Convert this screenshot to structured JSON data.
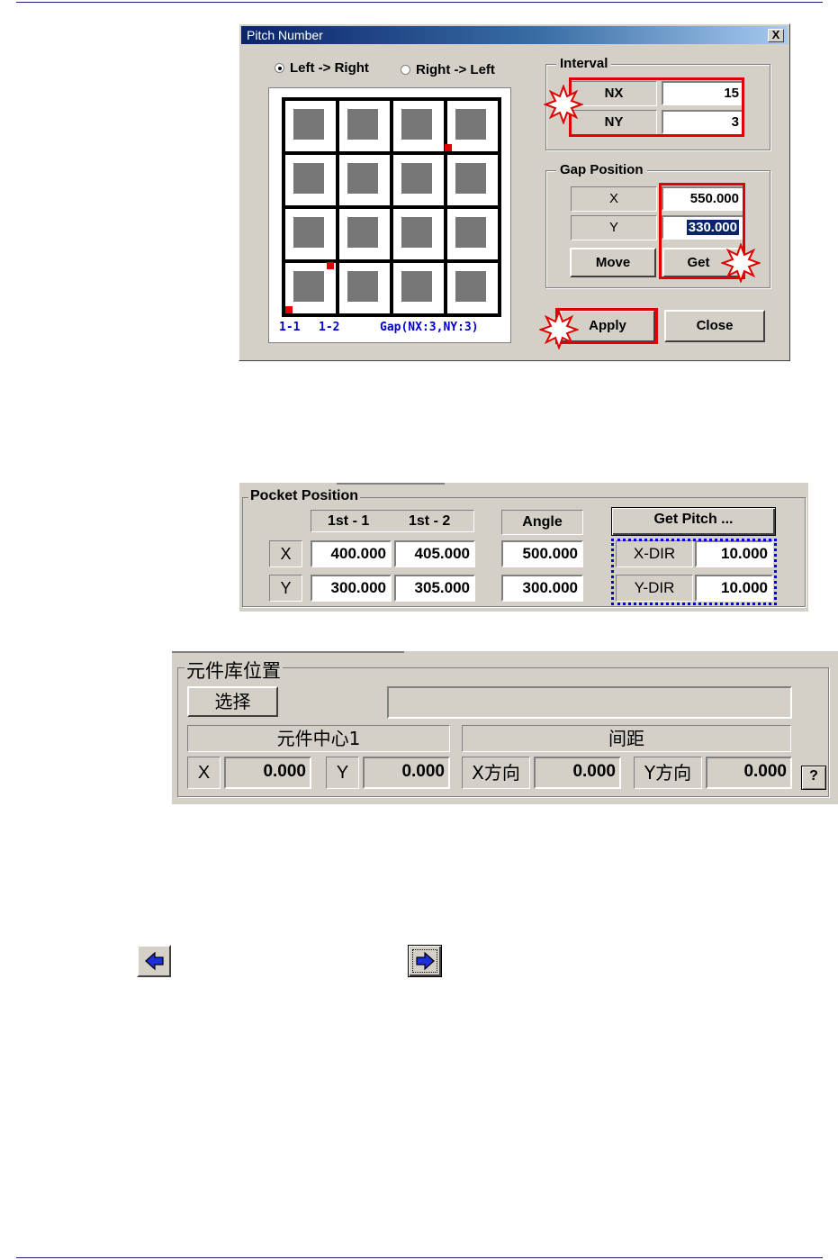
{
  "pitch_dialog": {
    "title": "Pitch Number",
    "close_label": "X",
    "radio_ltr": "Left -> Right",
    "radio_rtl": "Right -> Left",
    "legend_1_1": "1-1",
    "legend_1_2": "1-2",
    "legend_gap": "Gap(NX:3,NY:3)",
    "interval": {
      "title": "Interval",
      "nx_label": "NX",
      "nx_value": "15",
      "ny_label": "NY",
      "ny_value": "3"
    },
    "gap_position": {
      "title": "Gap Position",
      "x_label": "X",
      "x_value": "550.000",
      "y_label": "Y",
      "y_value": "330.000",
      "move_label": "Move",
      "get_label": "Get"
    },
    "apply_label": "Apply",
    "close_button_label": "Close"
  },
  "pocket_panel": {
    "title": "Pocket Position",
    "col_1st1": "1st - 1",
    "col_1st2": "1st  - 2",
    "col_angle": "Angle",
    "get_pitch_label": "Get Pitch ...",
    "row_x_label": "X",
    "row_y_label": "Y",
    "x_1st1": "400.000",
    "x_1st2": "405.000",
    "x_angle": "500.000",
    "y_1st1": "300.000",
    "y_1st2": "305.000",
    "y_angle": "300.000",
    "xdir_label": "X-DIR",
    "xdir_value": "10.000",
    "ydir_label": "Y-DIR",
    "ydir_value": "10.000"
  },
  "cn_panel": {
    "title": "元件库位置",
    "select_label": "选择",
    "center_header": "元件中心1",
    "spacing_header": "间距",
    "x_label": "X",
    "x_value": "0.000",
    "y_label": "Y",
    "y_value": "0.000",
    "xdir_label": "X方向",
    "xdir_value": "0.000",
    "ydir_label": "Y方向",
    "ydir_value": "0.000",
    "help_label": "?"
  },
  "colors": {
    "highlight_red": "#e00000",
    "dotted_blue": "#0000d0",
    "dialog_gray": "#d4d0c8",
    "rule_navy": "#22227a"
  }
}
